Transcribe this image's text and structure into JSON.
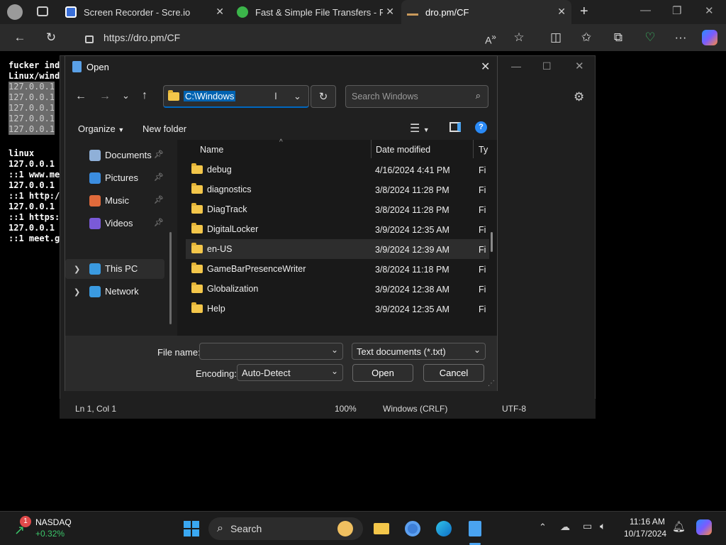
{
  "browser": {
    "tabs": [
      {
        "title": "Screen Recorder - Scre.io",
        "active": false
      },
      {
        "title": "Fast & Simple File Transfers - File",
        "active": false
      },
      {
        "title": "dro.pm/CF",
        "active": true
      }
    ],
    "url": "https://dro.pm/CF"
  },
  "notepad": {
    "code_lines": [
      {
        "text": "fucker ind",
        "hl": false
      },
      {
        "text": "Linux/wind",
        "hl": false
      },
      {
        "text": "127.0.0.1",
        "hl": true
      },
      {
        "text": "127.0.0.1",
        "hl": true
      },
      {
        "text": "127.0.0.1",
        "hl": true
      },
      {
        "text": "127.0.0.1",
        "hl": true
      },
      {
        "text": "127.0.0.1",
        "hl": true
      },
      {
        "text": "",
        "hl": false
      },
      {
        "text": "linux",
        "hl": false
      },
      {
        "text": "127.0.0.1",
        "hl": false
      },
      {
        "text": "::1 www.me",
        "hl": false
      },
      {
        "text": "127.0.0.1",
        "hl": false
      },
      {
        "text": "::1 http:/",
        "hl": false
      },
      {
        "text": "127.0.0.1",
        "hl": false
      },
      {
        "text": "::1 https:",
        "hl": false
      },
      {
        "text": "127.0.0.1",
        "hl": false
      },
      {
        "text": "::1 meet.g",
        "hl": false
      }
    ],
    "status": {
      "position": "Ln 1, Col 1",
      "zoom": "100%",
      "line_ending": "Windows (CRLF)",
      "encoding": "UTF-8"
    }
  },
  "dialog": {
    "title": "Open",
    "path": "C:\\Windows",
    "search_placeholder": "Search Windows",
    "organize_label": "Organize",
    "new_folder_label": "New folder",
    "nav_items": [
      {
        "label": "Documents",
        "icon": "documents-icon",
        "pinned": true
      },
      {
        "label": "Pictures",
        "icon": "pictures-icon",
        "pinned": true
      },
      {
        "label": "Music",
        "icon": "music-icon",
        "pinned": true
      },
      {
        "label": "Videos",
        "icon": "videos-icon",
        "pinned": true
      },
      {
        "label": "This PC",
        "icon": "this-pc-icon",
        "pinned": false
      },
      {
        "label": "Network",
        "icon": "network-icon",
        "pinned": false
      }
    ],
    "columns": {
      "name": "Name",
      "date": "Date modified",
      "type": "Ty"
    },
    "files": [
      {
        "name": "debug",
        "date": "4/16/2024 4:41 PM",
        "type": "Fi"
      },
      {
        "name": "diagnostics",
        "date": "3/8/2024 11:28 PM",
        "type": "Fi"
      },
      {
        "name": "DiagTrack",
        "date": "3/8/2024 11:28 PM",
        "type": "Fi"
      },
      {
        "name": "DigitalLocker",
        "date": "3/9/2024 12:35 AM",
        "type": "Fi"
      },
      {
        "name": "en-US",
        "date": "3/9/2024 12:39 AM",
        "type": "Fi",
        "selected": true
      },
      {
        "name": "GameBarPresenceWriter",
        "date": "3/8/2024 11:18 PM",
        "type": "Fi"
      },
      {
        "name": "Globalization",
        "date": "3/9/2024 12:38 AM",
        "type": "Fi"
      },
      {
        "name": "Help",
        "date": "3/9/2024 12:35 AM",
        "type": "Fi"
      }
    ],
    "file_name_label": "File name:",
    "file_name_value": "",
    "file_type": "Text documents (*.txt)",
    "encoding_label": "Encoding:",
    "encoding_value": "Auto-Detect",
    "open_label": "Open",
    "cancel_label": "Cancel"
  },
  "taskbar": {
    "stock_name": "NASDAQ",
    "stock_change": "+0.32%",
    "stock_badge": "1",
    "search_label": "Search",
    "time": "11:16 AM",
    "date": "10/17/2024"
  },
  "colors": {
    "accent": "#0067c0",
    "folder": "#f3c64a",
    "selection": "#0063b1"
  }
}
